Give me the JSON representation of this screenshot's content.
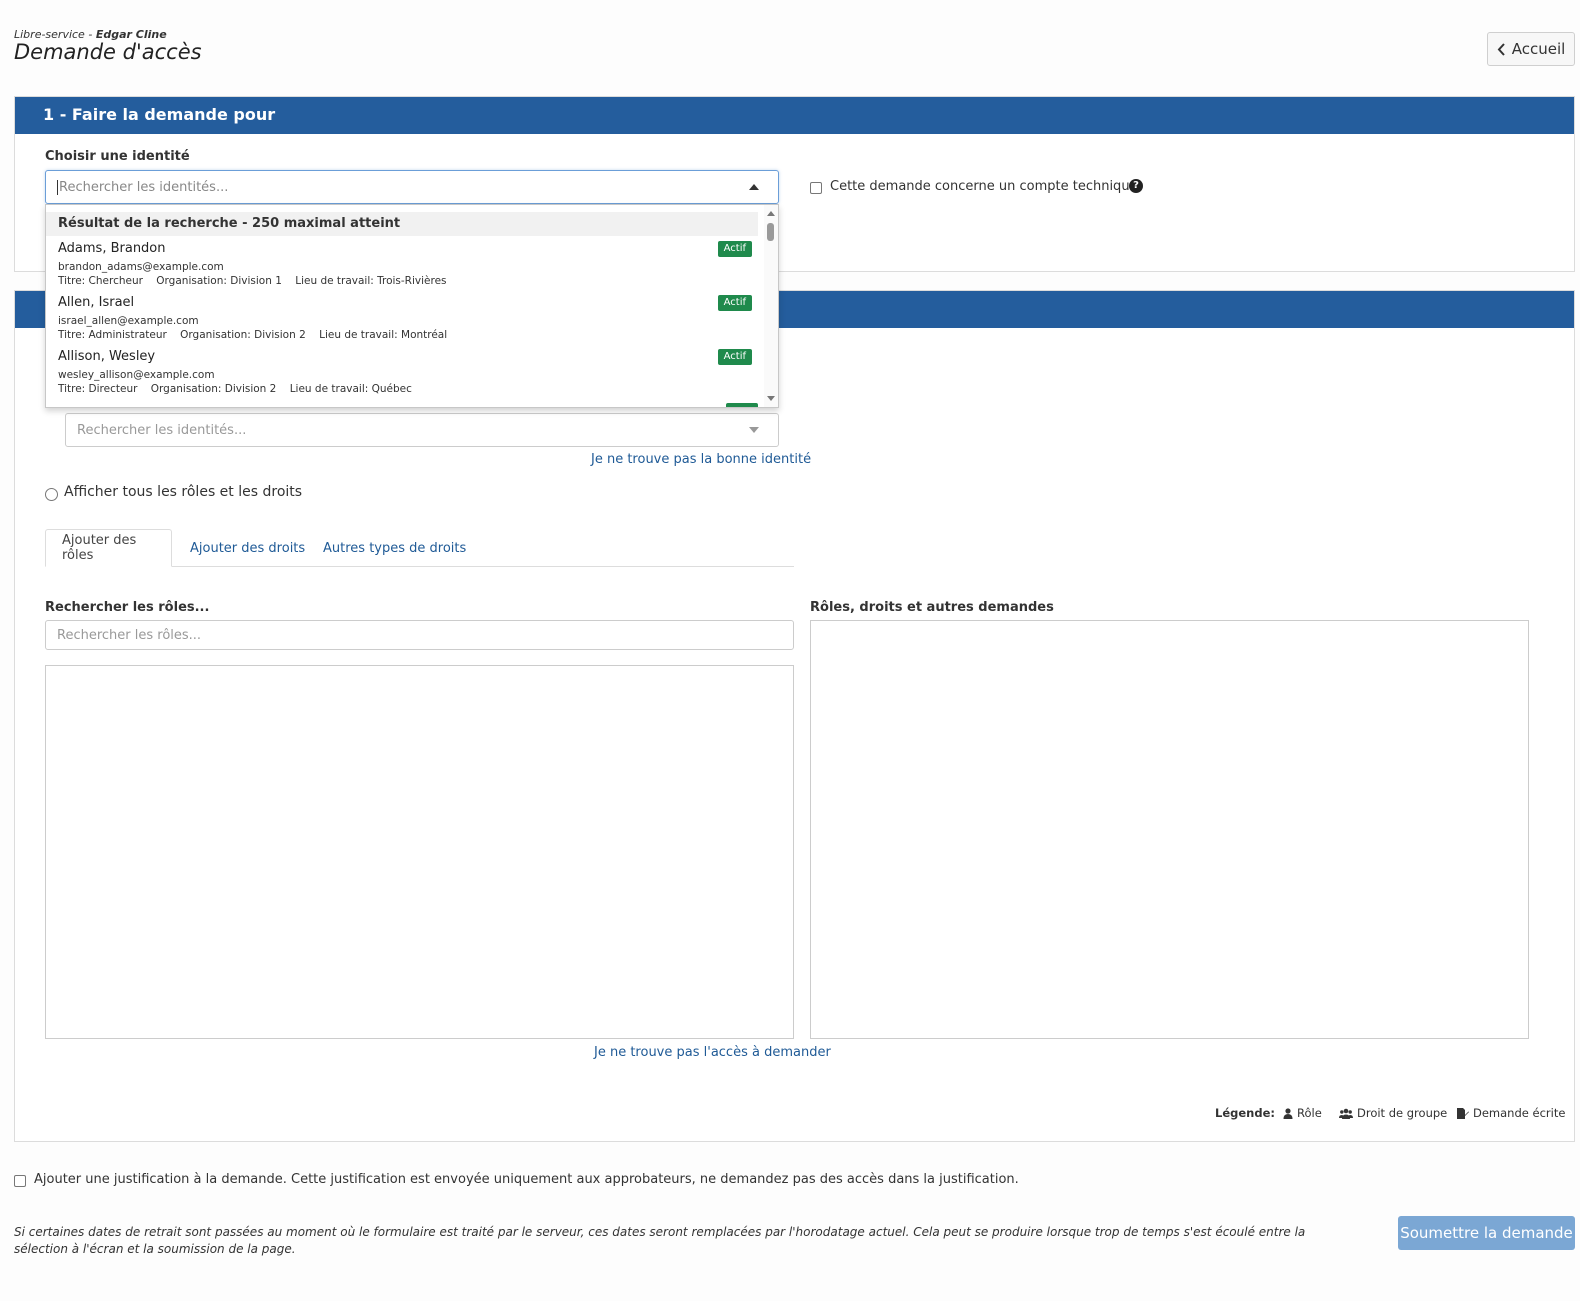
{
  "header": {
    "crumb_app": "Libre-service",
    "crumb_sep": " - ",
    "crumb_user": "Edgar Cline",
    "title": "Demande d'accès",
    "home_label": "Accueil"
  },
  "section1": {
    "title": "1 - Faire la demande pour",
    "identity_label": "Choisir une identité",
    "identity_placeholder": "Rechercher les identités...",
    "technical_account_label": "Cette demande concerne un compte technique"
  },
  "dropdown": {
    "header": "Résultat de la recherche - 250 maximal atteint",
    "items": [
      {
        "name": "Adams, Brandon",
        "email": "brandon_adams@example.com",
        "meta": "Titre: Chercheur    Organisation: Division 1    Lieu de travail: Trois-Rivières",
        "status": "Actif"
      },
      {
        "name": "Allen, Israel",
        "email": "israel_allen@example.com",
        "meta": "Titre: Administrateur    Organisation: Division 2    Lieu de travail: Montréal",
        "status": "Actif"
      },
      {
        "name": "Allison, Wesley",
        "email": "wesley_allison@example.com",
        "meta": "Titre: Directeur    Organisation: Division 2    Lieu de travail: Québec",
        "status": "Actif"
      }
    ]
  },
  "section2": {
    "identity_placeholder": "Rechercher les identités...",
    "not_found_identity": "Je ne trouve pas la bonne identité",
    "show_all_label": "Afficher tous les rôles et les droits",
    "tabs": [
      "Ajouter des rôles",
      "Ajouter des droits",
      "Autres types de droits"
    ],
    "search_roles_label": "Rechercher les rôles...",
    "search_roles_placeholder": "Rechercher les rôles...",
    "selected_label": "Rôles, droits et autres demandes",
    "not_found_access": "Je ne trouve pas l'accès à demander",
    "legend_label": "Légende:",
    "legend_role": "Rôle",
    "legend_group": "Droit de groupe",
    "legend_written": "Demande écrite"
  },
  "footer": {
    "justification_label": "Ajouter une justification à la demande. Cette justification est envoyée uniquement aux approbateurs, ne demandez pas des accès dans la justification.",
    "note": "Si certaines dates de retrait sont passées au moment où le formulaire est traité par le serveur, ces dates seront remplacées par l'horodatage actuel. Cela peut se produire lorsque trop de temps s'est écoulé entre la sélection à l'écran et la soumission de la page.",
    "submit_label": "Soumettre la demande"
  },
  "colors": {
    "header_blue": "#245d9d",
    "badge_green": "#1f8a4c",
    "link_blue": "#1f5a96",
    "submit_blue": "#7ba7d4"
  }
}
